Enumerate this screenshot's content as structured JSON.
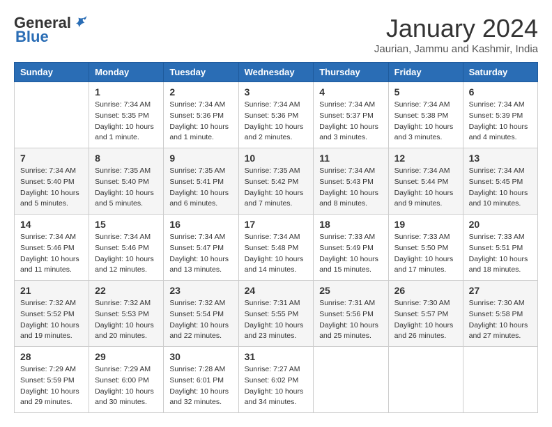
{
  "logo": {
    "general": "General",
    "blue": "Blue"
  },
  "header": {
    "month": "January 2024",
    "location": "Jaurian, Jammu and Kashmir, India"
  },
  "days_of_week": [
    "Sunday",
    "Monday",
    "Tuesday",
    "Wednesday",
    "Thursday",
    "Friday",
    "Saturday"
  ],
  "weeks": [
    [
      {
        "day": "",
        "sunrise": "",
        "sunset": "",
        "daylight": ""
      },
      {
        "day": "1",
        "sunrise": "Sunrise: 7:34 AM",
        "sunset": "Sunset: 5:35 PM",
        "daylight": "Daylight: 10 hours and 1 minute."
      },
      {
        "day": "2",
        "sunrise": "Sunrise: 7:34 AM",
        "sunset": "Sunset: 5:36 PM",
        "daylight": "Daylight: 10 hours and 1 minute."
      },
      {
        "day": "3",
        "sunrise": "Sunrise: 7:34 AM",
        "sunset": "Sunset: 5:36 PM",
        "daylight": "Daylight: 10 hours and 2 minutes."
      },
      {
        "day": "4",
        "sunrise": "Sunrise: 7:34 AM",
        "sunset": "Sunset: 5:37 PM",
        "daylight": "Daylight: 10 hours and 3 minutes."
      },
      {
        "day": "5",
        "sunrise": "Sunrise: 7:34 AM",
        "sunset": "Sunset: 5:38 PM",
        "daylight": "Daylight: 10 hours and 3 minutes."
      },
      {
        "day": "6",
        "sunrise": "Sunrise: 7:34 AM",
        "sunset": "Sunset: 5:39 PM",
        "daylight": "Daylight: 10 hours and 4 minutes."
      }
    ],
    [
      {
        "day": "7",
        "sunrise": "Sunrise: 7:34 AM",
        "sunset": "Sunset: 5:40 PM",
        "daylight": "Daylight: 10 hours and 5 minutes."
      },
      {
        "day": "8",
        "sunrise": "Sunrise: 7:35 AM",
        "sunset": "Sunset: 5:40 PM",
        "daylight": "Daylight: 10 hours and 5 minutes."
      },
      {
        "day": "9",
        "sunrise": "Sunrise: 7:35 AM",
        "sunset": "Sunset: 5:41 PM",
        "daylight": "Daylight: 10 hours and 6 minutes."
      },
      {
        "day": "10",
        "sunrise": "Sunrise: 7:35 AM",
        "sunset": "Sunset: 5:42 PM",
        "daylight": "Daylight: 10 hours and 7 minutes."
      },
      {
        "day": "11",
        "sunrise": "Sunrise: 7:34 AM",
        "sunset": "Sunset: 5:43 PM",
        "daylight": "Daylight: 10 hours and 8 minutes."
      },
      {
        "day": "12",
        "sunrise": "Sunrise: 7:34 AM",
        "sunset": "Sunset: 5:44 PM",
        "daylight": "Daylight: 10 hours and 9 minutes."
      },
      {
        "day": "13",
        "sunrise": "Sunrise: 7:34 AM",
        "sunset": "Sunset: 5:45 PM",
        "daylight": "Daylight: 10 hours and 10 minutes."
      }
    ],
    [
      {
        "day": "14",
        "sunrise": "Sunrise: 7:34 AM",
        "sunset": "Sunset: 5:46 PM",
        "daylight": "Daylight: 10 hours and 11 minutes."
      },
      {
        "day": "15",
        "sunrise": "Sunrise: 7:34 AM",
        "sunset": "Sunset: 5:46 PM",
        "daylight": "Daylight: 10 hours and 12 minutes."
      },
      {
        "day": "16",
        "sunrise": "Sunrise: 7:34 AM",
        "sunset": "Sunset: 5:47 PM",
        "daylight": "Daylight: 10 hours and 13 minutes."
      },
      {
        "day": "17",
        "sunrise": "Sunrise: 7:34 AM",
        "sunset": "Sunset: 5:48 PM",
        "daylight": "Daylight: 10 hours and 14 minutes."
      },
      {
        "day": "18",
        "sunrise": "Sunrise: 7:33 AM",
        "sunset": "Sunset: 5:49 PM",
        "daylight": "Daylight: 10 hours and 15 minutes."
      },
      {
        "day": "19",
        "sunrise": "Sunrise: 7:33 AM",
        "sunset": "Sunset: 5:50 PM",
        "daylight": "Daylight: 10 hours and 17 minutes."
      },
      {
        "day": "20",
        "sunrise": "Sunrise: 7:33 AM",
        "sunset": "Sunset: 5:51 PM",
        "daylight": "Daylight: 10 hours and 18 minutes."
      }
    ],
    [
      {
        "day": "21",
        "sunrise": "Sunrise: 7:32 AM",
        "sunset": "Sunset: 5:52 PM",
        "daylight": "Daylight: 10 hours and 19 minutes."
      },
      {
        "day": "22",
        "sunrise": "Sunrise: 7:32 AM",
        "sunset": "Sunset: 5:53 PM",
        "daylight": "Daylight: 10 hours and 20 minutes."
      },
      {
        "day": "23",
        "sunrise": "Sunrise: 7:32 AM",
        "sunset": "Sunset: 5:54 PM",
        "daylight": "Daylight: 10 hours and 22 minutes."
      },
      {
        "day": "24",
        "sunrise": "Sunrise: 7:31 AM",
        "sunset": "Sunset: 5:55 PM",
        "daylight": "Daylight: 10 hours and 23 minutes."
      },
      {
        "day": "25",
        "sunrise": "Sunrise: 7:31 AM",
        "sunset": "Sunset: 5:56 PM",
        "daylight": "Daylight: 10 hours and 25 minutes."
      },
      {
        "day": "26",
        "sunrise": "Sunrise: 7:30 AM",
        "sunset": "Sunset: 5:57 PM",
        "daylight": "Daylight: 10 hours and 26 minutes."
      },
      {
        "day": "27",
        "sunrise": "Sunrise: 7:30 AM",
        "sunset": "Sunset: 5:58 PM",
        "daylight": "Daylight: 10 hours and 27 minutes."
      }
    ],
    [
      {
        "day": "28",
        "sunrise": "Sunrise: 7:29 AM",
        "sunset": "Sunset: 5:59 PM",
        "daylight": "Daylight: 10 hours and 29 minutes."
      },
      {
        "day": "29",
        "sunrise": "Sunrise: 7:29 AM",
        "sunset": "Sunset: 6:00 PM",
        "daylight": "Daylight: 10 hours and 30 minutes."
      },
      {
        "day": "30",
        "sunrise": "Sunrise: 7:28 AM",
        "sunset": "Sunset: 6:01 PM",
        "daylight": "Daylight: 10 hours and 32 minutes."
      },
      {
        "day": "31",
        "sunrise": "Sunrise: 7:27 AM",
        "sunset": "Sunset: 6:02 PM",
        "daylight": "Daylight: 10 hours and 34 minutes."
      },
      {
        "day": "",
        "sunrise": "",
        "sunset": "",
        "daylight": ""
      },
      {
        "day": "",
        "sunrise": "",
        "sunset": "",
        "daylight": ""
      },
      {
        "day": "",
        "sunrise": "",
        "sunset": "",
        "daylight": ""
      }
    ]
  ]
}
